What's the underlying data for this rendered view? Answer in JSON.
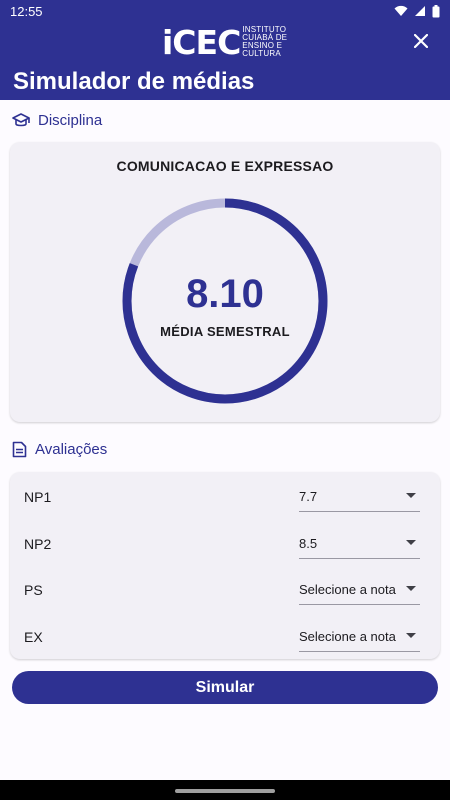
{
  "status": {
    "time": "12:55"
  },
  "header": {
    "logo_mark": "iCEC",
    "logo_text": [
      "Instituto",
      "Cuiabá de",
      "Ensino e",
      "Cultura"
    ],
    "title": "Simulador de médias"
  },
  "discipline_section": {
    "label": "Disciplina",
    "subject": "COMUNICACAO E EXPRESSAO",
    "average": "8.10",
    "average_label": "MÉDIA SEMESTRAL",
    "average_fraction": 0.81,
    "colors": {
      "progress": "#2e3192",
      "track": "#b9b8db"
    }
  },
  "evaluations_section": {
    "label": "Avaliações",
    "rows": [
      {
        "label": "NP1",
        "value": "7.7"
      },
      {
        "label": "NP2",
        "value": "8.5"
      },
      {
        "label": "PS",
        "value": "Selecione a nota"
      },
      {
        "label": "EX",
        "value": "Selecione a nota"
      }
    ]
  },
  "simulate_button": "Simular",
  "colors": {
    "primary": "#2e3192",
    "background": "#fdfbff",
    "card": "#f2f0f6"
  }
}
